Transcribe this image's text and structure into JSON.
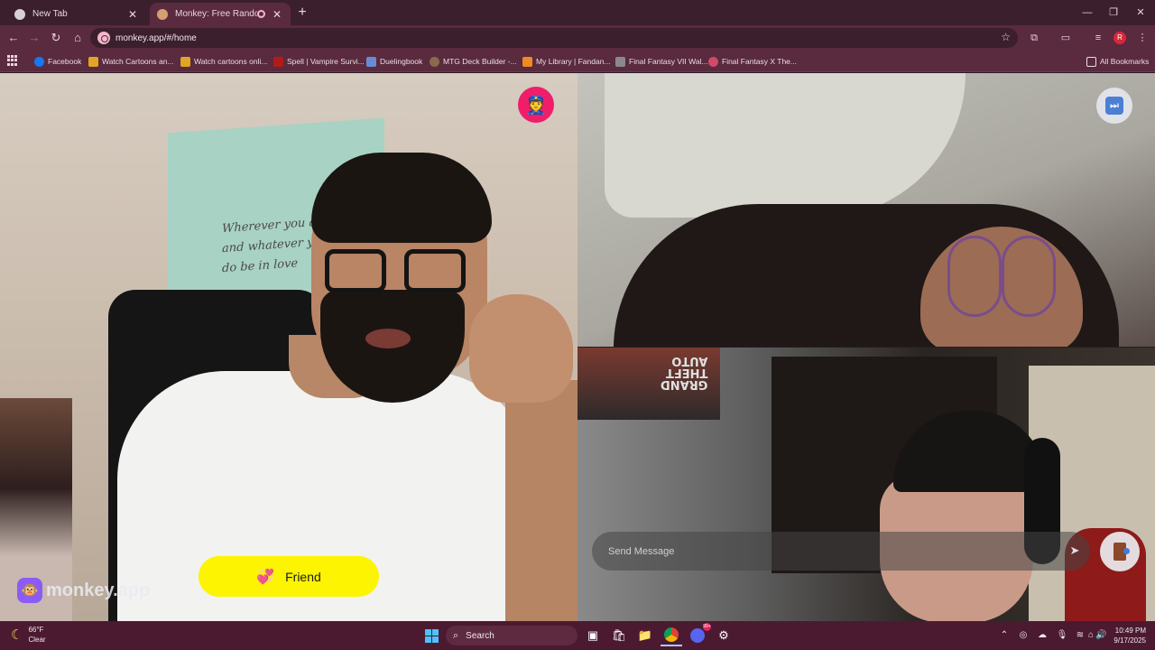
{
  "browser": {
    "tabs": [
      {
        "title": "New Tab",
        "active": false
      },
      {
        "title": "Monkey: Free Random Vide",
        "active": true,
        "playing_audio": true
      }
    ],
    "url": "monkey.app/#/home",
    "profile_initial": "R",
    "bookmarks": [
      {
        "label": "Facebook",
        "color": "#1877f2"
      },
      {
        "label": "Watch Cartoons an...",
        "color": "#e0a526"
      },
      {
        "label": "Watch cartoons onli...",
        "color": "#e0a526"
      },
      {
        "label": "Spell | Vampire Survi...",
        "color": "#b31b1b"
      },
      {
        "label": "Duelingbook",
        "color": "#6a8ad6"
      },
      {
        "label": "MTG Deck Builder -...",
        "color": "#8a6a4a"
      },
      {
        "label": "My Library | Fandan...",
        "color": "#f08a24"
      },
      {
        "label": "Final Fantasy VII Wal...",
        "color": "#8a8a8a"
      },
      {
        "label": "Final Fantasy X The...",
        "color": "#d04a6a"
      }
    ],
    "all_bookmarks": "All Bookmarks"
  },
  "app": {
    "brand": "monkey.app",
    "friend_button": "Friend",
    "message_placeholder": "Send Message",
    "accent_colors": {
      "report": "#f01d6b",
      "friend": "#fcf400",
      "logo": "#8a5cf5"
    }
  },
  "video": {
    "wall_quote": "Wherever you are and whatever you do be in love"
  },
  "taskbar": {
    "weather_temp": "66°F",
    "weather_desc": "Clear",
    "search_label": "Search",
    "time": "10:49 PM",
    "date": "9/17/2025",
    "discord_badge": "99+"
  }
}
